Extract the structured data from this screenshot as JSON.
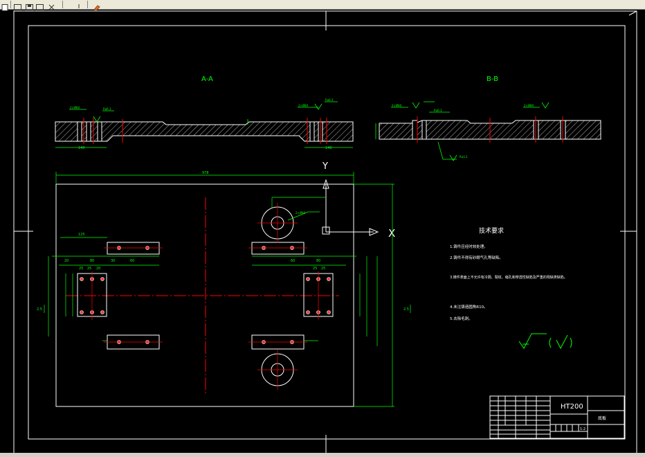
{
  "toolbar": {
    "icons": [
      "new-file-icon",
      "open-file-icon",
      "save-icon",
      "close-icon",
      "cursor-icon",
      "paint-icon"
    ]
  },
  "colors": {
    "background": "#000000",
    "frame": "#ffffff",
    "dimension": "#00ff00",
    "centerline": "#ff0000",
    "hole": "#ff5050"
  },
  "drawing": {
    "section_a_label": "A-A",
    "section_b_label": "B-B",
    "view_y_label": "Y",
    "view_x_label": "X",
    "dim_overall_width": "978",
    "dim_125": "125",
    "dim_140_left": "140",
    "dim_140_right": "140",
    "dim_20a": "20",
    "dim_80a": "80",
    "dim_60a": "60",
    "dim_25a": "25",
    "dim_25b": "25",
    "dim_20b": "20",
    "dim_80b": "80",
    "dim_25c": "25",
    "dim_25d": "25",
    "dim_30": "30",
    "dim_60b": "60",
    "dim_r_left": "2.5",
    "dim_r_right": "2.5",
    "callout_hole": "2×Ø80",
    "roughness_a": "Ra6.3",
    "roughness_b": "Ra6.3",
    "roughness_c": "Ra3.2"
  },
  "technical_requirements": {
    "title": "技术要求",
    "items": [
      "1.铸件应经时效处理。",
      "2.铸件不得有砂眼气孔等缺陷。",
      "3.铸件表面上不允许有冷隔、裂纹、缩孔和穿透性缺陷及严重的残缺类缺陷。",
      "4.未注铸造圆角R10。",
      "5.去除毛刺。"
    ]
  },
  "title_block": {
    "material": "HT200",
    "part_name": "底板",
    "scale": "1:2"
  }
}
